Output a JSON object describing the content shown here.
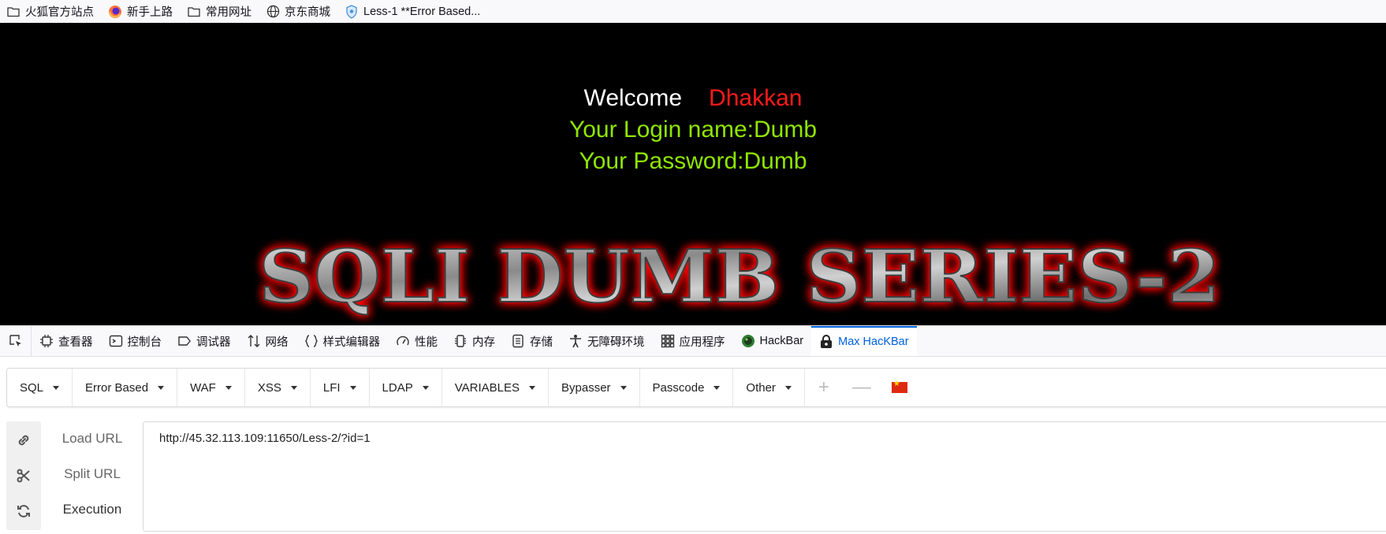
{
  "bookmarks": [
    {
      "label": "火狐官方站点",
      "icon": "folder-icon"
    },
    {
      "label": "新手上路",
      "icon": "firefox-icon"
    },
    {
      "label": "常用网址",
      "icon": "folder-icon"
    },
    {
      "label": "京东商城",
      "icon": "globe-icon"
    },
    {
      "label": "Less-1 **Error Based...",
      "icon": "shield-icon"
    }
  ],
  "page": {
    "welcome": "Welcome",
    "name": "Dhakkan",
    "login_line": "Your Login name:Dumb",
    "password_line": "Your Password:Dumb",
    "banner_text": "SQLI DUMB SERIES-2"
  },
  "devtools": {
    "tabs": [
      {
        "label": "查看器",
        "icon": "inspector-icon"
      },
      {
        "label": "控制台",
        "icon": "console-icon"
      },
      {
        "label": "调试器",
        "icon": "debugger-icon"
      },
      {
        "label": "网络",
        "icon": "network-icon"
      },
      {
        "label": "样式编辑器",
        "icon": "style-editor-icon"
      },
      {
        "label": "性能",
        "icon": "performance-icon"
      },
      {
        "label": "内存",
        "icon": "memory-icon"
      },
      {
        "label": "存储",
        "icon": "storage-icon"
      },
      {
        "label": "无障碍环境",
        "icon": "accessibility-icon"
      },
      {
        "label": "应用程序",
        "icon": "application-icon"
      },
      {
        "label": "HackBar",
        "icon": "hackbar-icon"
      },
      {
        "label": "Max HacKBar",
        "icon": "max-hackbar-icon"
      }
    ],
    "active_tab": "Max HacKBar",
    "accent": "#0061e0"
  },
  "hackbar": {
    "menus": [
      "SQL",
      "Error Based",
      "WAF",
      "XSS",
      "LFI",
      "LDAP",
      "VARIABLES",
      "Bypasser",
      "Passcode",
      "Other"
    ],
    "actions": {
      "load": "Load URL",
      "split": "Split URL",
      "execute": "Execution"
    },
    "url": "http://45.32.113.109:11650/Less-2/?id=1"
  },
  "colors": {
    "welcome": "#ffffff",
    "name": "#ff1a1a",
    "credentials": "#8fe600",
    "banner_glow": "#ff0000"
  }
}
